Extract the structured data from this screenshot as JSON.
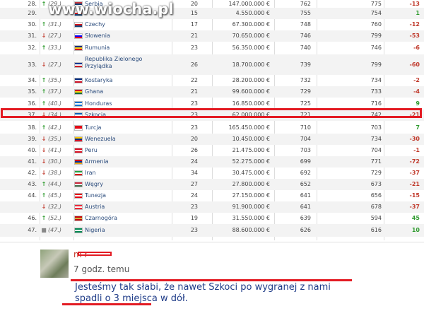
{
  "watermark": "www.wiocha.pl",
  "rows": [
    {
      "rank": "28.",
      "dir": "up",
      "prev": "(29.)",
      "flag": [
        "#c6363c",
        "#0c4076",
        "#ffffff"
      ],
      "country": "Serbia",
      "matches": "20",
      "value": "147.000.000 €",
      "pts1": "762",
      "pts2": "775",
      "diff": "-13"
    },
    {
      "rank": "29.",
      "dir": "",
      "prev": "",
      "flag": [
        "#ffffff",
        "#d7141a",
        "#11457e"
      ],
      "country": "",
      "matches": "15",
      "value": "4.550.000 €",
      "pts1": "755",
      "pts2": "754",
      "diff": "1"
    },
    {
      "rank": "30.",
      "dir": "up",
      "prev": "(31.)",
      "flag": [
        "#ffffff",
        "#d7141a",
        "#11457e"
      ],
      "country": "Czechy",
      "matches": "17",
      "value": "67.300.000 €",
      "pts1": "748",
      "pts2": "760",
      "diff": "-12"
    },
    {
      "rank": "31.",
      "dir": "down",
      "prev": "(27.)",
      "flag": [
        "#ffffff",
        "#0000ff",
        "#ff0000"
      ],
      "country": "Słowenia",
      "matches": "21",
      "value": "70.650.000 €",
      "pts1": "746",
      "pts2": "799",
      "diff": "-53"
    },
    {
      "rank": "32.",
      "dir": "up",
      "prev": "(33.)",
      "flag": [
        "#002b7f",
        "#fcd116",
        "#ce1126"
      ],
      "country": "Rumunia",
      "matches": "23",
      "value": "56.350.000 €",
      "pts1": "740",
      "pts2": "746",
      "diff": "-6"
    },
    {
      "rank": "33.",
      "dir": "down",
      "prev": "(27.)",
      "flag": [
        "#003893",
        "#ffffff",
        "#cf2027"
      ],
      "country": "Republika Zielonego Przylądka",
      "matches": "26",
      "value": "18.700.000 €",
      "pts1": "739",
      "pts2": "799",
      "diff": "-60"
    },
    {
      "rank": "34.",
      "dir": "up",
      "prev": "(35.)",
      "flag": [
        "#002b7f",
        "#ffffff",
        "#ce1126"
      ],
      "country": "Kostaryka",
      "matches": "22",
      "value": "28.200.000 €",
      "pts1": "732",
      "pts2": "734",
      "diff": "-2"
    },
    {
      "rank": "35.",
      "dir": "up",
      "prev": "(37.)",
      "flag": [
        "#ce1126",
        "#fcd116",
        "#006b3f"
      ],
      "country": "Ghana",
      "matches": "21",
      "value": "99.600.000 €",
      "pts1": "729",
      "pts2": "733",
      "diff": "-4"
    },
    {
      "rank": "36.",
      "dir": "up",
      "prev": "(40.)",
      "flag": [
        "#0073cf",
        "#ffffff",
        "#0073cf"
      ],
      "country": "Honduras",
      "matches": "23",
      "value": "16.850.000 €",
      "pts1": "725",
      "pts2": "716",
      "diff": "9"
    },
    {
      "rank": "37.",
      "dir": "down",
      "prev": "(34.)",
      "flag": [
        "#005eb8",
        "#ffffff",
        "#005eb8"
      ],
      "country": "Szkocja",
      "matches": "23",
      "value": "62.000.000 €",
      "pts1": "721",
      "pts2": "742",
      "diff": "-21"
    },
    {
      "rank": "38.",
      "dir": "up",
      "prev": "(42.)",
      "flag": [
        "#e30a17",
        "#e30a17",
        "#ffffff"
      ],
      "country": "Turcja",
      "matches": "23",
      "value": "165.450.000 €",
      "pts1": "710",
      "pts2": "703",
      "diff": "7"
    },
    {
      "rank": "39.",
      "dir": "down",
      "prev": "(35.)",
      "flag": [
        "#ffcc00",
        "#00247d",
        "#cf142b"
      ],
      "country": "Wenezuela",
      "matches": "20",
      "value": "10.450.000 €",
      "pts1": "704",
      "pts2": "734",
      "diff": "-30"
    },
    {
      "rank": "40.",
      "dir": "down",
      "prev": "(41.)",
      "flag": [
        "#d91023",
        "#ffffff",
        "#d91023"
      ],
      "country": "Peru",
      "matches": "26",
      "value": "21.475.000 €",
      "pts1": "703",
      "pts2": "704",
      "diff": "-1"
    },
    {
      "rank": "41.",
      "dir": "down",
      "prev": "(30.)",
      "flag": [
        "#d90012",
        "#0033a0",
        "#f2a800"
      ],
      "country": "Armenia",
      "matches": "24",
      "value": "52.275.000 €",
      "pts1": "699",
      "pts2": "771",
      "diff": "-72"
    },
    {
      "rank": "42.",
      "dir": "down",
      "prev": "(38.)",
      "flag": [
        "#239f40",
        "#ffffff",
        "#da0000"
      ],
      "country": "Iran",
      "matches": "34",
      "value": "30.475.000 €",
      "pts1": "692",
      "pts2": "729",
      "diff": "-37"
    },
    {
      "rank": "43.",
      "dir": "up",
      "prev": "(44.)",
      "flag": [
        "#cd2a3e",
        "#ffffff",
        "#436f4d"
      ],
      "country": "Węgry",
      "matches": "27",
      "value": "27.800.000 €",
      "pts1": "652",
      "pts2": "673",
      "diff": "-21"
    },
    {
      "rank": "44.",
      "dir": "up",
      "prev": "(45.)",
      "flag": [
        "#e70013",
        "#ffffff",
        "#e70013"
      ],
      "country": "Tunezja",
      "matches": "24",
      "value": "27.150.000 €",
      "pts1": "641",
      "pts2": "656",
      "diff": "-15"
    },
    {
      "rank": "",
      "dir": "down",
      "prev": "(32.)",
      "flag": [
        "#ed2939",
        "#ffffff",
        "#ed2939"
      ],
      "country": "Austria",
      "matches": "23",
      "value": "91.900.000 €",
      "pts1": "641",
      "pts2": "678",
      "diff": "-37"
    },
    {
      "rank": "46.",
      "dir": "up",
      "prev": "(52.)",
      "flag": [
        "#c40308",
        "#d4af3a",
        "#c40308"
      ],
      "country": "Czarnogóra",
      "matches": "19",
      "value": "31.550.000 €",
      "pts1": "639",
      "pts2": "594",
      "diff": "45"
    },
    {
      "rank": "47.",
      "dir": "same",
      "prev": "(47.)",
      "flag": [
        "#008751",
        "#ffffff",
        "#008751"
      ],
      "country": "Nigeria",
      "matches": "23",
      "value": "88.600.000 €",
      "pts1": "626",
      "pts2": "616",
      "diff": "10"
    }
  ],
  "comment": {
    "author": "m r",
    "time": "7 godz. temu",
    "text": "Jesteśmy tak słabi, że nawet Szkoci po wygranej z nami spadli o 3 miejsca w dół."
  },
  "colors": {
    "up": "#2e9b2e",
    "down": "#c0392b",
    "same": "#888888",
    "neg": "#c0392b",
    "pos": "#2e9b2e",
    "highlight": "#e31b23"
  }
}
